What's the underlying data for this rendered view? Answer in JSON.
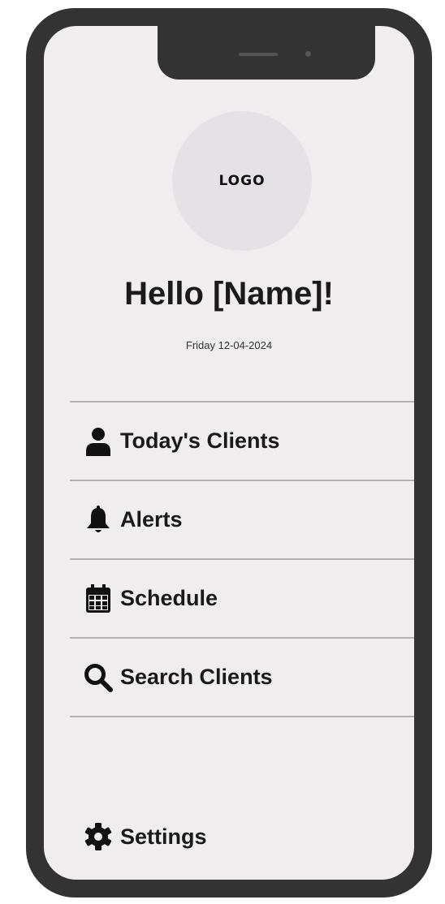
{
  "header": {
    "logo_text": "LOGO",
    "greeting": "Hello [Name]!",
    "date": "Friday 12-04-2024"
  },
  "menu": {
    "items": [
      {
        "label": "Today's Clients",
        "icon": "person-icon"
      },
      {
        "label": "Alerts",
        "icon": "bell-icon"
      },
      {
        "label": "Schedule",
        "icon": "calendar-icon"
      },
      {
        "label": "Search Clients",
        "icon": "search-icon"
      }
    ]
  },
  "footer": {
    "settings_label": "Settings",
    "settings_icon": "gear-icon"
  },
  "colors": {
    "device_frame": "#333333",
    "screen_bg": "#efedee",
    "logo_circle": "#e5e2e6",
    "text": "#1a1a1a",
    "divider": "#b3b1b3"
  }
}
